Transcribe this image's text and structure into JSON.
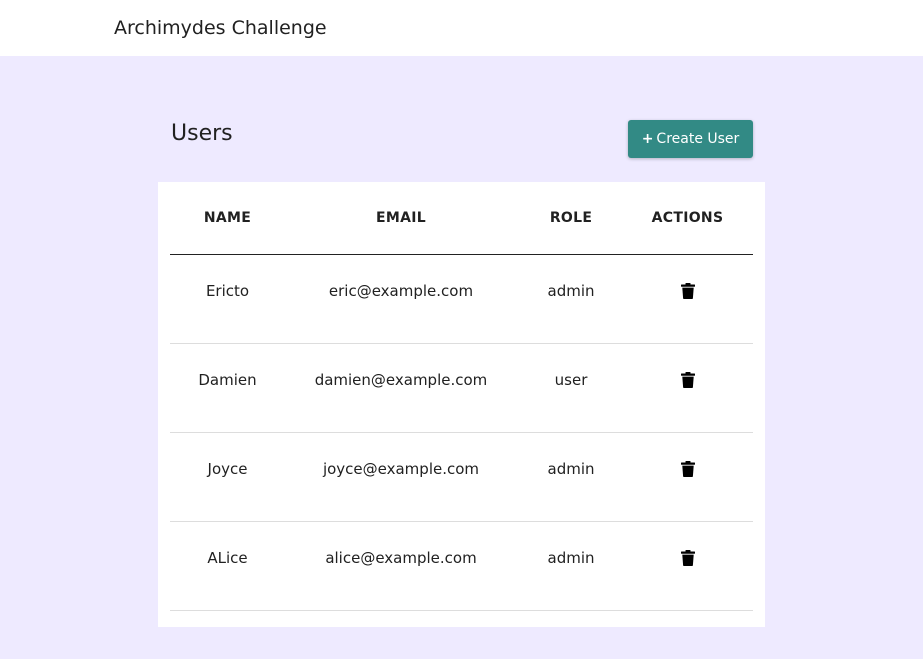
{
  "header": {
    "app_title": "Archimydes Challenge"
  },
  "main": {
    "page_title": "Users",
    "create_button": {
      "icon": "+",
      "label": "Create User"
    }
  },
  "table": {
    "columns": [
      "NAME",
      "EMAIL",
      "ROLE",
      "ACTIONS"
    ],
    "rows": [
      {
        "name": "Ericto",
        "email": "eric@example.com",
        "role": "admin",
        "action_icon": "trash-icon"
      },
      {
        "name": "Damien",
        "email": "damien@example.com",
        "role": "user",
        "action_icon": "trash-icon"
      },
      {
        "name": "Joyce",
        "email": "joyce@example.com",
        "role": "admin",
        "action_icon": "trash-icon"
      },
      {
        "name": "ALice",
        "email": "alice@example.com",
        "role": "admin",
        "action_icon": "trash-icon"
      }
    ]
  },
  "colors": {
    "header_bg": "#ffffff",
    "page_bg": "#eeeaff",
    "accent": "#328a85",
    "card_bg": "#ffffff",
    "text": "#212121"
  }
}
